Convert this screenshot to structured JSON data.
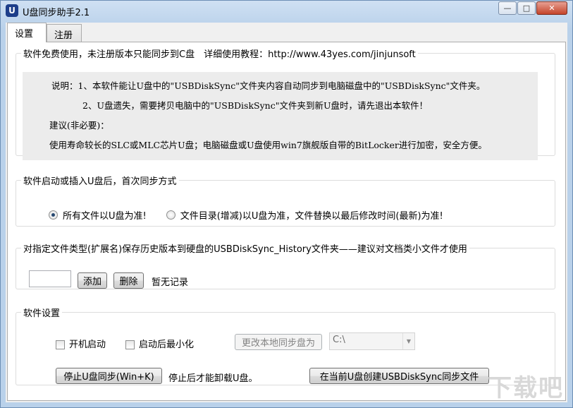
{
  "window": {
    "title": "U盘同步助手2.1",
    "icon_letter": "U",
    "minimize_glyph": "—",
    "maximize_glyph": "□",
    "close_glyph": "✕"
  },
  "tabs": [
    {
      "label": "设置",
      "active": true
    },
    {
      "label": "注册",
      "active": false
    }
  ],
  "info_group": {
    "legend": "软件免费使用，未注册版本只能同步到C盘　详细使用教程：http://www.43yes.com/jinjunsoft",
    "lines": [
      "说明：1、本软件能让U盘中的\"USBDiskSync\"文件夹内容自动同步到电脑磁盘中的\"USBDiskSync\"文件夹。",
      "2、U盘遗失，需要拷贝电脑中的\"USBDiskSync\"文件夹到新U盘时，请先退出本软件！",
      "建议(非必要)：",
      "使用寿命较长的SLC或MLC芯片U盘；电脑磁盘或U盘使用win7旗舰版自带的BitLocker进行加密，安全方便。"
    ]
  },
  "sync_mode_group": {
    "legend": "软件启动或插入U盘后，首次同步方式",
    "options": [
      {
        "label": "所有文件以U盘为准!",
        "selected": true
      },
      {
        "label": "文件目录(增减)以U盘为准，文件替换以最后修改时间(最新)为准!",
        "selected": false
      }
    ]
  },
  "history_group": {
    "legend": "对指定文件类型(扩展名)保存历史版本到硬盘的USBDiskSync_History文件夹——建议对文档类小文件才使用",
    "extension_value": "",
    "add_label": "添加",
    "delete_label": "删除",
    "empty_text": "暂无记录"
  },
  "settings_group": {
    "legend": "软件设置",
    "autostart_label": "开机启动",
    "autostart_checked": false,
    "minimize_label": "启动后最小化",
    "minimize_checked": false,
    "change_local_label": "更改本地同步盘为",
    "drive_value": "C:\\",
    "stop_label": "停止U盘同步(Win+K)",
    "stop_hint": "停止后才能卸载U盘。",
    "create_label": "在当前U盘创建USBDiskSync同步文件"
  },
  "watermark": "下载吧"
}
